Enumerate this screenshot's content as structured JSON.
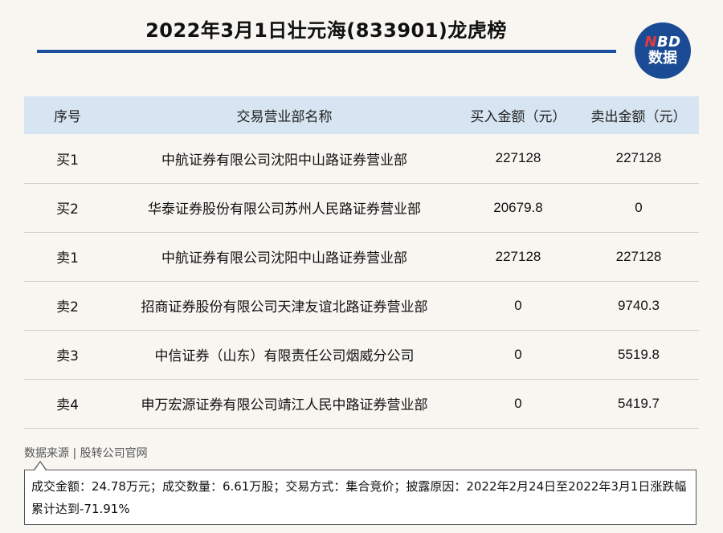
{
  "title": "2022年3月1日壮元海(833901)龙虎榜",
  "logo": {
    "line1_n": "N",
    "line1_rest": "BD",
    "line2": "数据"
  },
  "table": {
    "headers": [
      "序号",
      "交易营业部名称",
      "买入金额（元）",
      "卖出金额（元）"
    ],
    "rows": [
      [
        "买1",
        "中航证券有限公司沈阳中山路证券营业部",
        "227128",
        "227128"
      ],
      [
        "买2",
        "华泰证券股份有限公司苏州人民路证券营业部",
        "20679.8",
        "0"
      ],
      [
        "卖1",
        "中航证券有限公司沈阳中山路证券营业部",
        "227128",
        "227128"
      ],
      [
        "卖2",
        "招商证券股份有限公司天津友谊北路证券营业部",
        "0",
        "9740.3"
      ],
      [
        "卖3",
        "中信证券（山东）有限责任公司烟威分公司",
        "0",
        "5519.8"
      ],
      [
        "卖4",
        "申万宏源证券有限公司靖江人民中路证券营业部",
        "0",
        "5419.7"
      ]
    ]
  },
  "source": "数据来源 | 股转公司官网",
  "note": "成交金额：24.78万元；成交数量：6.61万股；交易方式：集合竞价；披露原因：2022年2月24日至2022年3月1日涨跌幅累计达到-71.91%",
  "colors": {
    "accent": "#1c4f9c",
    "header_bg": "#d6e5f1",
    "logo_bg": "#1c4b96",
    "logo_n": "#e23a3a"
  }
}
